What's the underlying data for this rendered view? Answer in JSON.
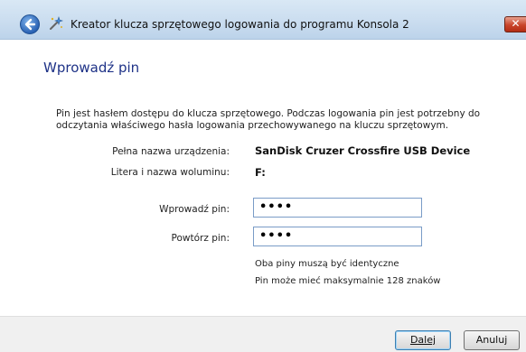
{
  "window": {
    "title": "Kreator klucza sprzętowego logowania do programu Konsola 2",
    "close_label": "✕"
  },
  "page": {
    "heading": "Wprowadź pin",
    "description": "Pin jest hasłem dostępu do klucza sprzętowego. Podczas logowania pin jest potrzebny do odczytania właściwego hasła logowania przechowywanego na kluczu sprzętowym."
  },
  "device": {
    "name_label": "Pełna nazwa urządzenia:",
    "name_value": "SanDisk Cruzer Crossfire USB Device",
    "volume_label": "Litera i nazwa woluminu:",
    "volume_value": "F:"
  },
  "pin": {
    "enter_label": "Wprowadź pin:",
    "enter_value": "••••",
    "repeat_label": "Powtórz pin:",
    "repeat_value": "••••",
    "note_match": "Oba piny muszą być identyczne",
    "note_max": "Pin może mieć maksymalnie 128 znaków"
  },
  "buttons": {
    "next_label": "Dalej",
    "next_rest": "alej",
    "cancel_label": "Anuluj"
  },
  "icons": {
    "back": "back-arrow-icon",
    "app": "wizard-icon",
    "close": "close-icon"
  }
}
